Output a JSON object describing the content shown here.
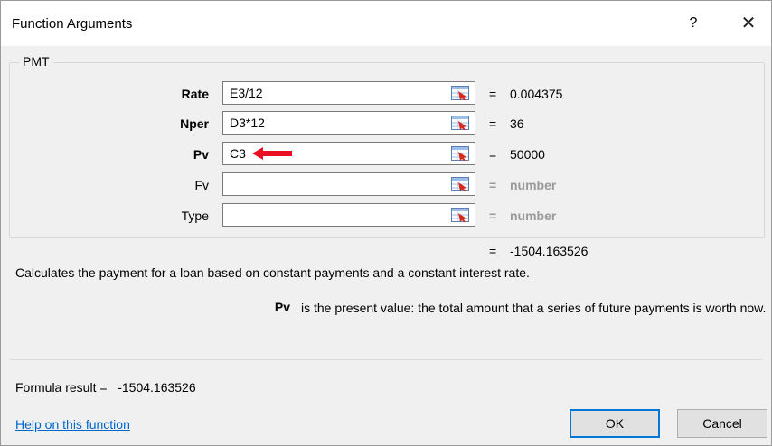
{
  "dialog": {
    "title": "Function Arguments",
    "help_glyph": "?",
    "close_glyph": "✕"
  },
  "function_name": "PMT",
  "arguments": [
    {
      "label": "Rate",
      "value": "E3/12",
      "result": "0.004375",
      "bold": true
    },
    {
      "label": "Nper",
      "value": "D3*12",
      "result": "36",
      "bold": true
    },
    {
      "label": "Pv",
      "value": "C3",
      "result": "50000",
      "bold": true
    },
    {
      "label": "Fv",
      "value": "",
      "result": "number",
      "bold": false
    },
    {
      "label": "Type",
      "value": "",
      "result": "number",
      "bold": false
    }
  ],
  "equals_sign": "=",
  "function_result": "-1504.163526",
  "description": "Calculates the payment for a loan based on constant payments and a constant interest rate.",
  "param_help": {
    "name": "Pv",
    "text": "is the present value: the total amount that a series of future payments is worth now."
  },
  "formula_result": {
    "label": "Formula result =",
    "value": "-1504.163526"
  },
  "help_link": "Help on this function",
  "buttons": {
    "ok": "OK",
    "cancel": "Cancel"
  },
  "colors": {
    "accent": "#0078d7",
    "link": "#0066cc",
    "annotation_arrow": "#e81123"
  },
  "icons": {
    "collapse": "range-selector-icon",
    "annotation": "red-arrow-icon"
  }
}
